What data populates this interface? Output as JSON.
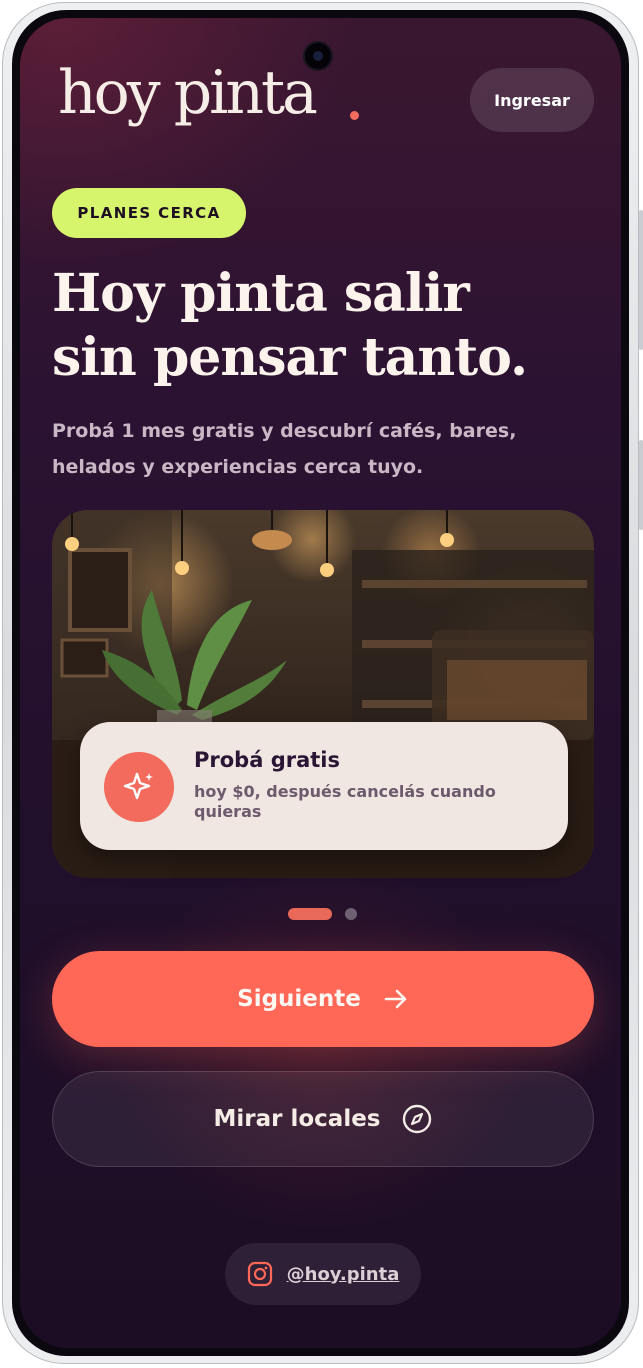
{
  "app": {
    "logo_text": "hoy pinta",
    "login_label": "Ingresar"
  },
  "hero": {
    "badge": "PLANES CERCA",
    "headline_line1": "Hoy pinta salir",
    "headline_line2": "sin pensar tanto.",
    "subtitle_line1": "Probá 1 mes gratis y descubrí cafés, bares,",
    "subtitle_line2": "helados y experiencias cerca tuyo.",
    "image_icon": "cafe-interior-photo"
  },
  "promo": {
    "icon": "sparkles-icon",
    "title": "Probá gratis",
    "text": "hoy $0, después cancelás cuando quieras"
  },
  "pagination": {
    "current": 1,
    "total": 2
  },
  "actions": {
    "primary_label": "Siguiente",
    "primary_icon": "arrow-right-icon",
    "secondary_label": "Mirar locales",
    "secondary_icon": "compass-icon"
  },
  "social": {
    "icon": "instagram-icon",
    "handle": "@hoy.pinta"
  },
  "colors": {
    "accent": "#ff6757",
    "badge": "#d6f46c",
    "background": "#21102c",
    "text": "#fbf3ec"
  }
}
